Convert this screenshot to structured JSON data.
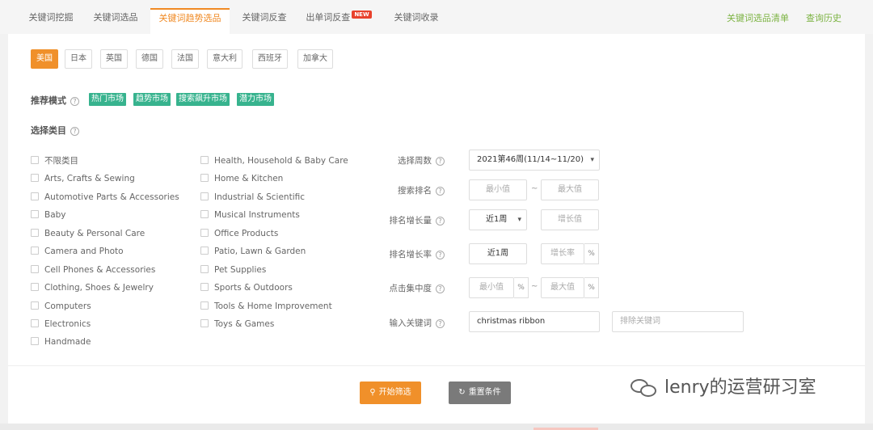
{
  "tabs": [
    {
      "label": "关键词挖掘"
    },
    {
      "label": "关键词选品"
    },
    {
      "label": "关键词趋势选品"
    },
    {
      "label": "关键词反查"
    },
    {
      "label": "出单词反查",
      "badge": "NEW"
    },
    {
      "label": "关键词收录"
    }
  ],
  "active_tab": "关键词趋势选品",
  "toplinks": {
    "list": "关键词选品清单",
    "history": "查询历史"
  },
  "countries": [
    "美国",
    "日本",
    "英国",
    "德国",
    "法国",
    "意大利",
    "西班牙",
    "加拿大"
  ],
  "selected_country": "美国",
  "mode": {
    "label": "推荐模式",
    "tags": [
      "热门市场",
      "趋势市场",
      "搜索飙升市场",
      "潜力市场"
    ]
  },
  "category": {
    "label": "选择类目",
    "col1": [
      "不限类目",
      "Arts, Crafts & Sewing",
      "Automotive Parts & Accessories",
      "Baby",
      "Beauty & Personal Care",
      "Camera and Photo",
      "Cell Phones & Accessories",
      "Clothing, Shoes & Jewelry",
      "Computers",
      "Electronics",
      "Handmade"
    ],
    "col2": [
      "Health, Household & Baby Care",
      "Home & Kitchen",
      "Industrial & Scientific",
      "Musical Instruments",
      "Office Products",
      "Patio, Lawn & Garden",
      "Pet Supplies",
      "Sports & Outdoors",
      "Tools & Home Improvement",
      "Toys & Games"
    ]
  },
  "filters": {
    "week": {
      "label": "选择周数",
      "value": "2021第46周(11/14~11/20)"
    },
    "rank": {
      "label": "搜索排名",
      "min_placeholder": "最小值",
      "max_placeholder": "最大值"
    },
    "rank_growth": {
      "label": "排名增长量",
      "period": "近1周",
      "placeholder": "增长值"
    },
    "rank_growth_rate": {
      "label": "排名增长率",
      "period": "近1周",
      "placeholder": "增长率",
      "unit": "%"
    },
    "click_concentration": {
      "label": "点击集中度",
      "min_placeholder": "最小值",
      "max_placeholder": "最大值",
      "unit": "%"
    },
    "keyword": {
      "label": "输入关键词",
      "value": "christmas ribbon",
      "exclude_placeholder": "排除关键词"
    }
  },
  "dash": "~",
  "help_glyph": "?",
  "buttons": {
    "start": "开始筛选",
    "reset": "重置条件"
  },
  "watermark": "lenry的运营研习室",
  "colors": {
    "accent": "#f0902a",
    "tag_green": "#37b38e",
    "link_green": "#7cb342"
  }
}
